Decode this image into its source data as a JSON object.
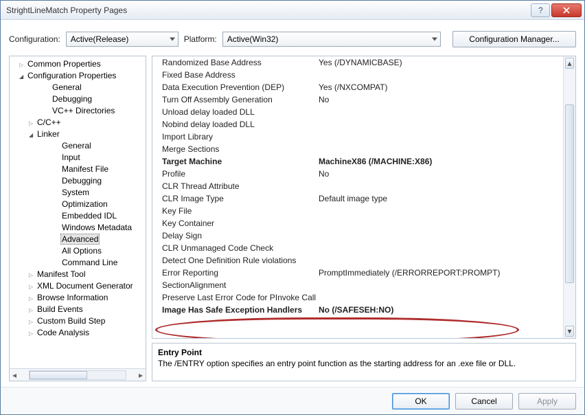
{
  "window": {
    "title": "StrightLineMatch Property Pages"
  },
  "toprow": {
    "config_label": "Configuration:",
    "config_value": "Active(Release)",
    "platform_label": "Platform:",
    "platform_value": "Active(Win32)",
    "cfgmgr_label": "Configuration Manager..."
  },
  "tree": [
    {
      "d": 0,
      "arrow": "closed",
      "label": "Common Properties"
    },
    {
      "d": 0,
      "arrow": "open",
      "label": "Configuration Properties"
    },
    {
      "d": 2,
      "arrow": "",
      "label": "General"
    },
    {
      "d": 2,
      "arrow": "",
      "label": "Debugging"
    },
    {
      "d": 2,
      "arrow": "",
      "label": "VC++ Directories"
    },
    {
      "d": 1,
      "arrow": "closed",
      "label": "C/C++"
    },
    {
      "d": 1,
      "arrow": "open",
      "label": "Linker"
    },
    {
      "d": 3,
      "arrow": "",
      "label": "General"
    },
    {
      "d": 3,
      "arrow": "",
      "label": "Input"
    },
    {
      "d": 3,
      "arrow": "",
      "label": "Manifest File"
    },
    {
      "d": 3,
      "arrow": "",
      "label": "Debugging"
    },
    {
      "d": 3,
      "arrow": "",
      "label": "System"
    },
    {
      "d": 3,
      "arrow": "",
      "label": "Optimization"
    },
    {
      "d": 3,
      "arrow": "",
      "label": "Embedded IDL"
    },
    {
      "d": 3,
      "arrow": "",
      "label": "Windows Metadata"
    },
    {
      "d": 3,
      "arrow": "",
      "label": "Advanced",
      "selected": true
    },
    {
      "d": 3,
      "arrow": "",
      "label": "All Options"
    },
    {
      "d": 3,
      "arrow": "",
      "label": "Command Line"
    },
    {
      "d": 1,
      "arrow": "closed",
      "label": "Manifest Tool"
    },
    {
      "d": 1,
      "arrow": "closed",
      "label": "XML Document Generator"
    },
    {
      "d": 1,
      "arrow": "closed",
      "label": "Browse Information"
    },
    {
      "d": 1,
      "arrow": "closed",
      "label": "Build Events"
    },
    {
      "d": 1,
      "arrow": "closed",
      "label": "Custom Build Step"
    },
    {
      "d": 1,
      "arrow": "closed",
      "label": "Code Analysis"
    }
  ],
  "props": [
    {
      "name": "Randomized Base Address",
      "value": "Yes (/DYNAMICBASE)"
    },
    {
      "name": "Fixed Base Address",
      "value": ""
    },
    {
      "name": "Data Execution Prevention (DEP)",
      "value": "Yes (/NXCOMPAT)"
    },
    {
      "name": "Turn Off Assembly Generation",
      "value": "No"
    },
    {
      "name": "Unload delay loaded DLL",
      "value": ""
    },
    {
      "name": "Nobind delay loaded DLL",
      "value": ""
    },
    {
      "name": "Import Library",
      "value": ""
    },
    {
      "name": "Merge Sections",
      "value": ""
    },
    {
      "name": "Target Machine",
      "value": "MachineX86 (/MACHINE:X86)",
      "bold": true
    },
    {
      "name": "Profile",
      "value": "No"
    },
    {
      "name": "CLR Thread Attribute",
      "value": ""
    },
    {
      "name": "CLR Image Type",
      "value": "Default image type"
    },
    {
      "name": "Key File",
      "value": ""
    },
    {
      "name": "Key Container",
      "value": ""
    },
    {
      "name": "Delay Sign",
      "value": ""
    },
    {
      "name": "CLR Unmanaged Code Check",
      "value": ""
    },
    {
      "name": "Detect One Definition Rule violations",
      "value": ""
    },
    {
      "name": "Error Reporting",
      "value": "PromptImmediately (/ERRORREPORT:PROMPT)"
    },
    {
      "name": "SectionAlignment",
      "value": ""
    },
    {
      "name": "Preserve Last Error Code for PInvoke Calls",
      "value": ""
    },
    {
      "name": "Image Has Safe Exception Handlers",
      "value": "No (/SAFESEH:NO)",
      "bold": true
    }
  ],
  "desc": {
    "title": "Entry Point",
    "text": "The /ENTRY option specifies an entry point function as the starting address for an .exe file or DLL."
  },
  "footer": {
    "ok": "OK",
    "cancel": "Cancel",
    "apply": "Apply"
  }
}
